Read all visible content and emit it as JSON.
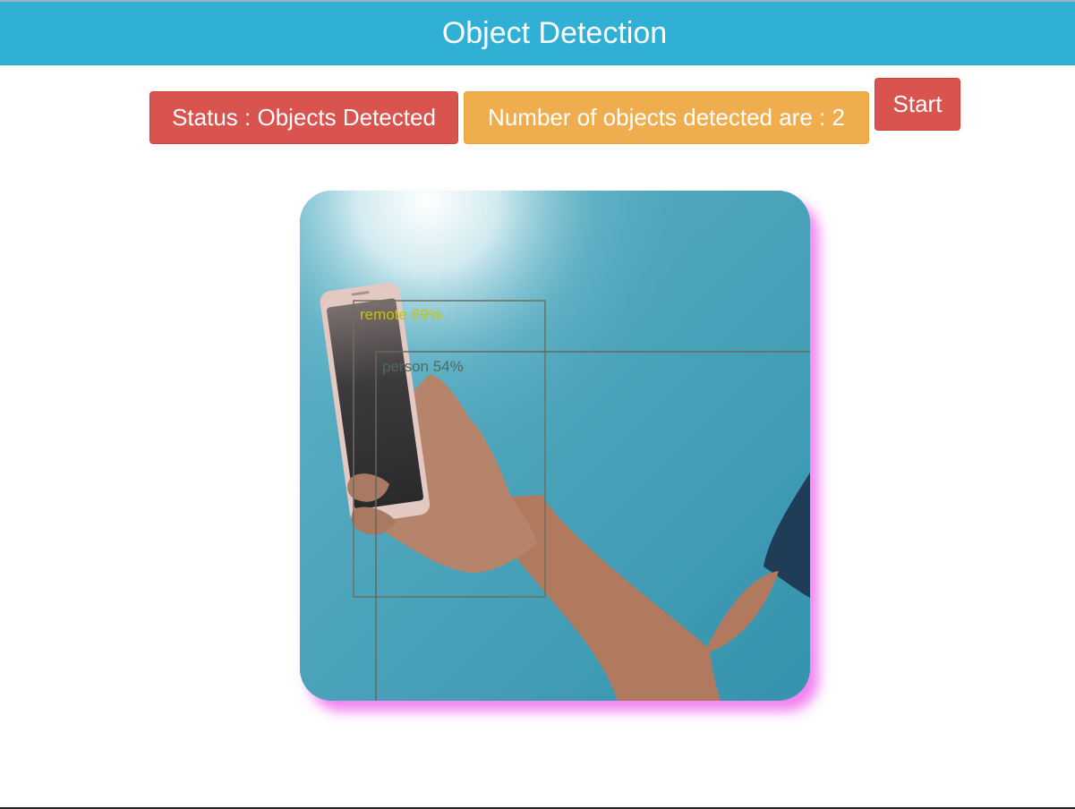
{
  "header": {
    "title": "Object Detection"
  },
  "controls": {
    "status_label": "Status : Objects Detected",
    "count_label": "Number of objects detected are : 2",
    "start_label": "Start"
  },
  "colors": {
    "header_bg": "#31b0d5",
    "danger": "#d9534f",
    "warning": "#f0ad4e",
    "video_shadow": "#ee5aee"
  },
  "detections": [
    {
      "label": "remote 69%",
      "color": "#c8c400"
    },
    {
      "label": "person 54%",
      "color": "#4f6a5c"
    }
  ]
}
